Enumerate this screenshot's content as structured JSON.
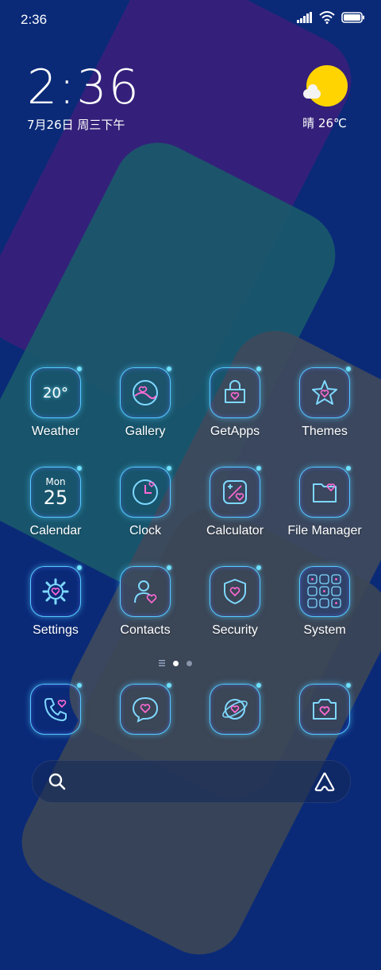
{
  "status_bar": {
    "time": "2:36"
  },
  "clock_widget": {
    "time": "2:36",
    "date": "7月26日 周三下午"
  },
  "weather_widget": {
    "text": "晴 26℃"
  },
  "apps": [
    {
      "label": "Weather",
      "icon": "weather-icon",
      "icon_text": "20°"
    },
    {
      "label": "Gallery",
      "icon": "gallery-icon"
    },
    {
      "label": "GetApps",
      "icon": "getapps-icon"
    },
    {
      "label": "Themes",
      "icon": "themes-icon"
    },
    {
      "label": "Calendar",
      "icon": "calendar-icon",
      "icon_day": "Mon",
      "icon_date": "25"
    },
    {
      "label": "Clock",
      "icon": "clock-icon"
    },
    {
      "label": "Calculator",
      "icon": "calculator-icon"
    },
    {
      "label": "File Manager",
      "icon": "file-manager-icon"
    },
    {
      "label": "Settings",
      "icon": "settings-icon"
    },
    {
      "label": "Contacts",
      "icon": "contacts-icon"
    },
    {
      "label": "Security",
      "icon": "security-icon"
    },
    {
      "label": "System",
      "icon": "system-folder-icon"
    }
  ],
  "dock": [
    {
      "icon": "phone-icon"
    },
    {
      "icon": "messages-icon"
    },
    {
      "icon": "browser-icon"
    },
    {
      "icon": "camera-icon"
    }
  ],
  "colors": {
    "background": "#0a2a78",
    "neon": "#55c9ff",
    "accent": "#ff6ad5",
    "sun": "#ffd400"
  }
}
